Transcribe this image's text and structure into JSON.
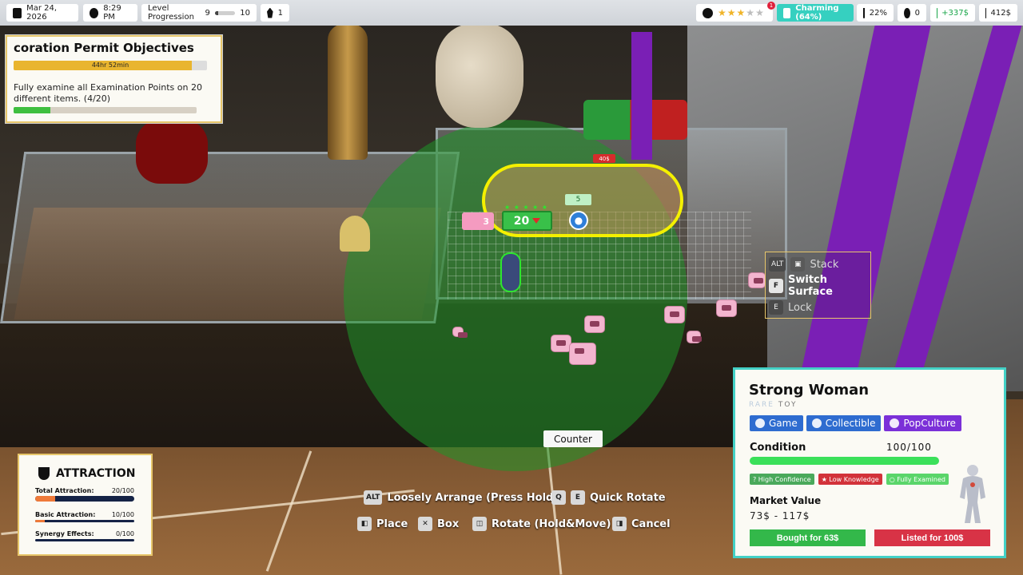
{
  "topbar": {
    "date": "Mar 24, 2026",
    "time": "8:29 PM",
    "level_label": "Level Progression",
    "level_from": "9",
    "level_to": "10",
    "level_progress": 0.15,
    "level_badge": "1",
    "rating_stars": 3,
    "rating_max": 5,
    "notification_count": "1",
    "charm": "Charming (64%)",
    "attraction_pct": "22%",
    "bombs": "0",
    "income": "+337$",
    "money": "412$"
  },
  "objectives": {
    "title": "coration Permit Objectives",
    "timer": "44hr 52min",
    "timer_progress": 0.92,
    "task": "Fully examine all Examination Points on 20 different items.",
    "task_count": "(4/20)",
    "task_progress": 0.2
  },
  "item_overlay": {
    "pig_count": "3",
    "attraction_value": "20",
    "mini_badge": "5",
    "price_tag": "40$"
  },
  "context_menu": {
    "stack_key": "ALT",
    "stack": "Stack",
    "switch_key": "F",
    "switch": "Switch Surface",
    "lock_key": "E",
    "lock": "Lock"
  },
  "surface_label": "Counter",
  "hints": {
    "alt_key": "ALT",
    "loosely_arrange": "Loosely Arrange (Press Hold)",
    "q_key": "Q",
    "e_key": "E",
    "quick_rotate": "Quick Rotate",
    "place": "Place",
    "box": "Box",
    "rotate": "Rotate (Hold&Move)",
    "cancel": "Cancel"
  },
  "attraction_panel": {
    "title": "ATTRACTION",
    "total_label": "Total Attraction:",
    "total_value": "20/100",
    "total_progress": 0.2,
    "basic_label": "Basic Attraction:",
    "basic_value": "10/100",
    "basic_progress": 0.1,
    "synergy_label": "Synergy Effects:",
    "synergy_value": "0/100",
    "synergy_progress": 0.0
  },
  "item_card": {
    "name": "Strong Woman",
    "rarity": "RARE",
    "category": "TOY",
    "tags": [
      "Game",
      "Collectible",
      "PopCulture"
    ],
    "condition_label": "Condition",
    "condition_value": "100/100",
    "condition_progress": 1.0,
    "chips": [
      "? High Confidence",
      "★ Low Knowledge",
      "○ Fully Examined"
    ],
    "market_label": "Market Value",
    "market_range": "73$ - 117$",
    "bought": "Bought for 63$",
    "listed": "Listed for 100$"
  },
  "colors": {
    "accent_teal": "#43d1c6",
    "gold_border": "#e7c66a",
    "green": "#33b84a",
    "red": "#d83346",
    "tag_blue": "#2e6cd0",
    "tag_purple": "#7b30d8"
  }
}
